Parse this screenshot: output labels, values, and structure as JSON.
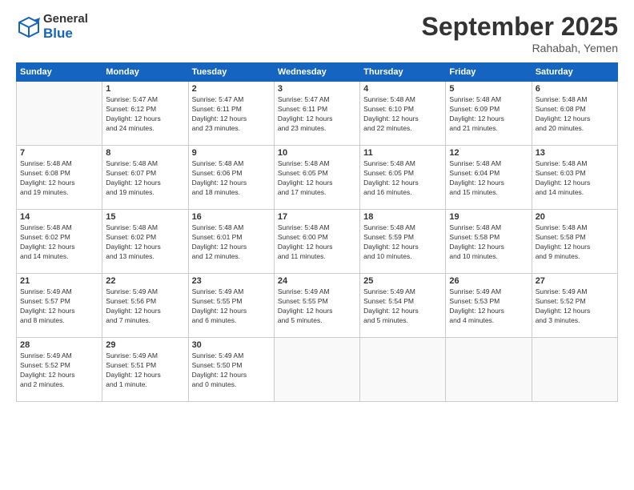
{
  "header": {
    "logo_general": "General",
    "logo_blue": "Blue",
    "month_title": "September 2025",
    "location": "Rahabah, Yemen"
  },
  "weekdays": [
    "Sunday",
    "Monday",
    "Tuesday",
    "Wednesday",
    "Thursday",
    "Friday",
    "Saturday"
  ],
  "weeks": [
    [
      {
        "day": "",
        "info": ""
      },
      {
        "day": "1",
        "info": "Sunrise: 5:47 AM\nSunset: 6:12 PM\nDaylight: 12 hours\nand 24 minutes."
      },
      {
        "day": "2",
        "info": "Sunrise: 5:47 AM\nSunset: 6:11 PM\nDaylight: 12 hours\nand 23 minutes."
      },
      {
        "day": "3",
        "info": "Sunrise: 5:47 AM\nSunset: 6:11 PM\nDaylight: 12 hours\nand 23 minutes."
      },
      {
        "day": "4",
        "info": "Sunrise: 5:48 AM\nSunset: 6:10 PM\nDaylight: 12 hours\nand 22 minutes."
      },
      {
        "day": "5",
        "info": "Sunrise: 5:48 AM\nSunset: 6:09 PM\nDaylight: 12 hours\nand 21 minutes."
      },
      {
        "day": "6",
        "info": "Sunrise: 5:48 AM\nSunset: 6:08 PM\nDaylight: 12 hours\nand 20 minutes."
      }
    ],
    [
      {
        "day": "7",
        "info": "Sunrise: 5:48 AM\nSunset: 6:08 PM\nDaylight: 12 hours\nand 19 minutes."
      },
      {
        "day": "8",
        "info": "Sunrise: 5:48 AM\nSunset: 6:07 PM\nDaylight: 12 hours\nand 19 minutes."
      },
      {
        "day": "9",
        "info": "Sunrise: 5:48 AM\nSunset: 6:06 PM\nDaylight: 12 hours\nand 18 minutes."
      },
      {
        "day": "10",
        "info": "Sunrise: 5:48 AM\nSunset: 6:05 PM\nDaylight: 12 hours\nand 17 minutes."
      },
      {
        "day": "11",
        "info": "Sunrise: 5:48 AM\nSunset: 6:05 PM\nDaylight: 12 hours\nand 16 minutes."
      },
      {
        "day": "12",
        "info": "Sunrise: 5:48 AM\nSunset: 6:04 PM\nDaylight: 12 hours\nand 15 minutes."
      },
      {
        "day": "13",
        "info": "Sunrise: 5:48 AM\nSunset: 6:03 PM\nDaylight: 12 hours\nand 14 minutes."
      }
    ],
    [
      {
        "day": "14",
        "info": "Sunrise: 5:48 AM\nSunset: 6:02 PM\nDaylight: 12 hours\nand 14 minutes."
      },
      {
        "day": "15",
        "info": "Sunrise: 5:48 AM\nSunset: 6:02 PM\nDaylight: 12 hours\nand 13 minutes."
      },
      {
        "day": "16",
        "info": "Sunrise: 5:48 AM\nSunset: 6:01 PM\nDaylight: 12 hours\nand 12 minutes."
      },
      {
        "day": "17",
        "info": "Sunrise: 5:48 AM\nSunset: 6:00 PM\nDaylight: 12 hours\nand 11 minutes."
      },
      {
        "day": "18",
        "info": "Sunrise: 5:48 AM\nSunset: 5:59 PM\nDaylight: 12 hours\nand 10 minutes."
      },
      {
        "day": "19",
        "info": "Sunrise: 5:48 AM\nSunset: 5:58 PM\nDaylight: 12 hours\nand 10 minutes."
      },
      {
        "day": "20",
        "info": "Sunrise: 5:48 AM\nSunset: 5:58 PM\nDaylight: 12 hours\nand 9 minutes."
      }
    ],
    [
      {
        "day": "21",
        "info": "Sunrise: 5:49 AM\nSunset: 5:57 PM\nDaylight: 12 hours\nand 8 minutes."
      },
      {
        "day": "22",
        "info": "Sunrise: 5:49 AM\nSunset: 5:56 PM\nDaylight: 12 hours\nand 7 minutes."
      },
      {
        "day": "23",
        "info": "Sunrise: 5:49 AM\nSunset: 5:55 PM\nDaylight: 12 hours\nand 6 minutes."
      },
      {
        "day": "24",
        "info": "Sunrise: 5:49 AM\nSunset: 5:55 PM\nDaylight: 12 hours\nand 5 minutes."
      },
      {
        "day": "25",
        "info": "Sunrise: 5:49 AM\nSunset: 5:54 PM\nDaylight: 12 hours\nand 5 minutes."
      },
      {
        "day": "26",
        "info": "Sunrise: 5:49 AM\nSunset: 5:53 PM\nDaylight: 12 hours\nand 4 minutes."
      },
      {
        "day": "27",
        "info": "Sunrise: 5:49 AM\nSunset: 5:52 PM\nDaylight: 12 hours\nand 3 minutes."
      }
    ],
    [
      {
        "day": "28",
        "info": "Sunrise: 5:49 AM\nSunset: 5:52 PM\nDaylight: 12 hours\nand 2 minutes."
      },
      {
        "day": "29",
        "info": "Sunrise: 5:49 AM\nSunset: 5:51 PM\nDaylight: 12 hours\nand 1 minute."
      },
      {
        "day": "30",
        "info": "Sunrise: 5:49 AM\nSunset: 5:50 PM\nDaylight: 12 hours\nand 0 minutes."
      },
      {
        "day": "",
        "info": ""
      },
      {
        "day": "",
        "info": ""
      },
      {
        "day": "",
        "info": ""
      },
      {
        "day": "",
        "info": ""
      }
    ]
  ]
}
